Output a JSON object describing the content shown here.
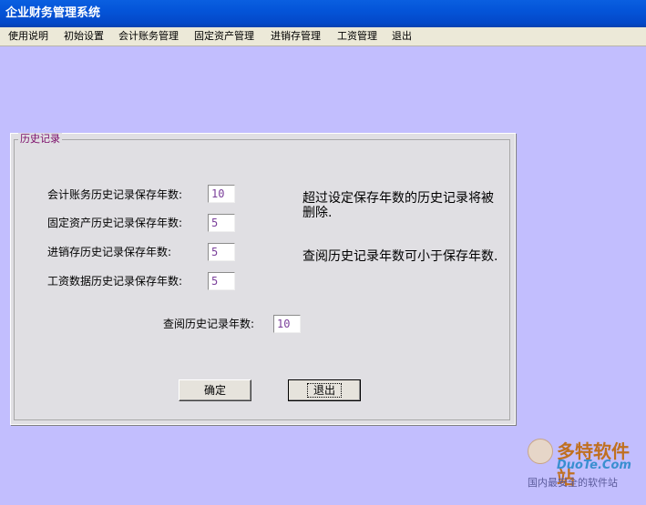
{
  "window": {
    "title": "企业财务管理系统"
  },
  "menu": {
    "items": [
      "使用说明",
      "初始设置",
      "会计账务管理",
      "固定资产管理",
      "进销存管理",
      "工资管理",
      "退出"
    ]
  },
  "history": {
    "group_title": "历史记录",
    "rows": [
      {
        "label": "会计账务历史记录保存年数:",
        "value": "10"
      },
      {
        "label": "固定资产历史记录保存年数:",
        "value": "5"
      },
      {
        "label": "进销存历史记录保存年数:",
        "value": "5"
      },
      {
        "label": "工资数据历史记录保存年数:",
        "value": "5"
      }
    ],
    "query": {
      "label": "查阅历史记录年数:",
      "value": "10"
    },
    "note1": "超过设定保存年数的历史记录将被删除.",
    "note2": "查阅历史记录年数可小于保存年数.",
    "ok_label": "确定",
    "exit_label": "退出"
  },
  "watermark": {
    "brand": "多特软件站",
    "domain": "DuoTe.Com",
    "slogan": "国内最安全的软件站"
  }
}
